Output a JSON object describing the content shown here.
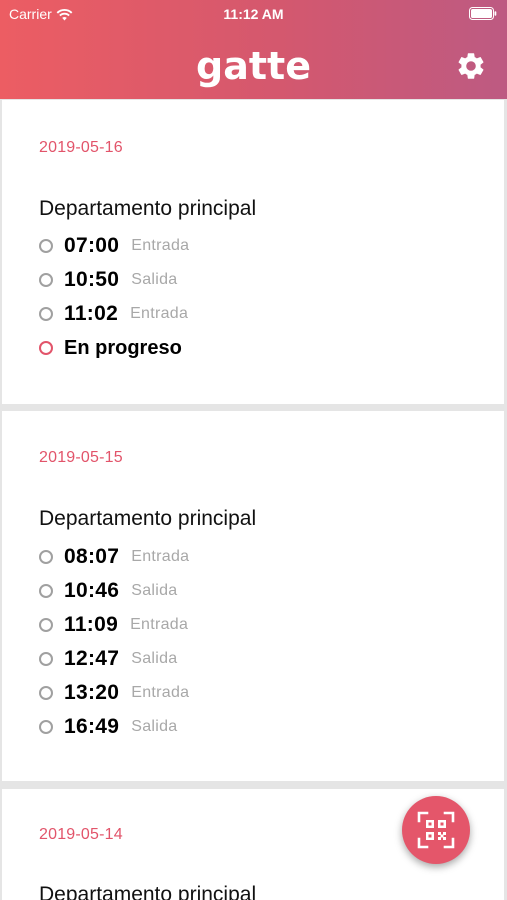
{
  "status_bar": {
    "carrier": "Carrier",
    "time": "11:12 AM"
  },
  "header": {
    "app_name": "gatte",
    "settings_icon": "gear-icon"
  },
  "days": [
    {
      "date": "2019-05-16",
      "department": "Departamento principal",
      "entries": [
        {
          "time": "07:00",
          "type": "Entrada"
        },
        {
          "time": "10:50",
          "type": "Salida"
        },
        {
          "time": "11:02",
          "type": "Entrada"
        }
      ],
      "progress": "En progreso"
    },
    {
      "date": "2019-05-15",
      "department": "Departamento principal",
      "entries": [
        {
          "time": "08:07",
          "type": "Entrada"
        },
        {
          "time": "10:46",
          "type": "Salida"
        },
        {
          "time": "11:09",
          "type": "Entrada"
        },
        {
          "time": "12:47",
          "type": "Salida"
        },
        {
          "time": "13:20",
          "type": "Entrada"
        },
        {
          "time": "16:49",
          "type": "Salida"
        }
      ]
    },
    {
      "date": "2019-05-14",
      "department": "Departamento principal",
      "entries": []
    }
  ],
  "fab": {
    "icon": "qr-code-scan-icon"
  },
  "colors": {
    "accent": "#e2546a",
    "header_start": "#ec5d63",
    "header_end": "#bd5a82"
  }
}
